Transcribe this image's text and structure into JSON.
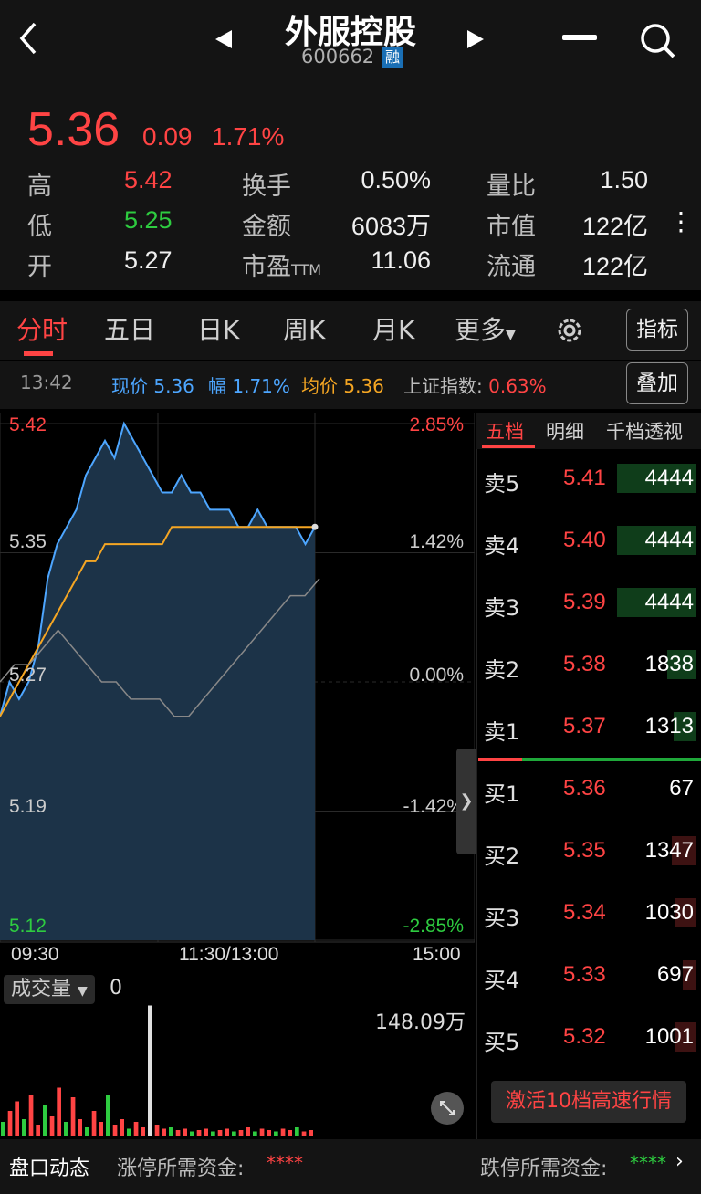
{
  "header": {
    "stock_name": "外服控股",
    "stock_code": "600662",
    "margin_badge": "融",
    "icons": [
      "back-chevron-icon",
      "prev-arrow-icon",
      "next-arrow-icon",
      "minus-icon",
      "search-icon"
    ]
  },
  "quote": {
    "price": "5.36",
    "change": "0.09",
    "change_pct": "1.71%",
    "high_label": "高",
    "high": "5.42",
    "low_label": "低",
    "low": "5.25",
    "open_label": "开",
    "open": "5.27",
    "turnover_label": "换手",
    "turnover": "0.50%",
    "amount_label": "金额",
    "amount": "6083万",
    "pe_label": "市盈",
    "pe_suffix": "TTM",
    "pe": "11.06",
    "vol_ratio_label": "量比",
    "vol_ratio": "1.50",
    "mktcap_label": "市值",
    "mktcap": "122亿",
    "float_label": "流通",
    "float": "122亿"
  },
  "tabs": {
    "items": [
      "分时",
      "五日",
      "日K",
      "周K",
      "月K",
      "更多"
    ],
    "active": "分时",
    "indicator_btn": "指标",
    "overlay_btn": "叠加"
  },
  "info": {
    "time": "13:42",
    "now_label": "现价",
    "now": "5.36",
    "amp_label": "幅",
    "amp": "1.71%",
    "avg_label": "均价",
    "avg": "5.36",
    "index_label": "上证指数:",
    "index_pct": "0.63%"
  },
  "chart_data": {
    "type": "line",
    "y_left_ticks": [
      "5.42",
      "5.35",
      "5.27",
      "5.19",
      "5.12"
    ],
    "y_right_ticks": [
      "2.85%",
      "1.42%",
      "0.00%",
      "-1.42%",
      "-2.85%"
    ],
    "x_ticks": [
      "09:30",
      "11:30/13:00",
      "15:00"
    ],
    "ylim": [
      5.12,
      5.42
    ],
    "prev_close": 5.27,
    "series": [
      {
        "values": [
          5.25,
          5.27,
          5.26,
          5.27,
          5.29,
          5.33,
          5.35,
          5.36,
          5.37,
          5.39,
          5.4,
          5.41,
          5.4,
          5.42,
          5.41,
          5.4,
          5.39,
          5.38,
          5.38,
          5.39,
          5.38,
          5.38,
          5.37,
          5.37,
          5.37,
          5.36,
          5.36,
          5.37,
          5.36,
          5.36,
          5.36,
          5.36,
          5.35,
          5.36
        ]
      },
      {
        "values": [
          5.25,
          5.26,
          5.27,
          5.28,
          5.29,
          5.3,
          5.31,
          5.32,
          5.33,
          5.34,
          5.34,
          5.35,
          5.35,
          5.35,
          5.35,
          5.35,
          5.35,
          5.35,
          5.36,
          5.36,
          5.36,
          5.36,
          5.36,
          5.36,
          5.36,
          5.36,
          5.36,
          5.36,
          5.36,
          5.36,
          5.36,
          5.36,
          5.36,
          5.36
        ]
      },
      {
        "values": [
          5.27,
          5.28,
          5.28,
          5.29,
          5.3,
          5.29,
          5.28,
          5.27,
          5.27,
          5.26,
          5.26,
          5.26,
          5.25,
          5.25,
          5.26,
          5.27,
          5.28,
          5.29,
          5.3,
          5.31,
          5.32,
          5.32,
          5.33
        ]
      }
    ],
    "colors": {
      "price": "#4da6ff",
      "avg": "#f5a623",
      "index": "#888888"
    }
  },
  "volume": {
    "label": "成交量",
    "value": "0",
    "max": "148.09万",
    "bars": [
      0.1,
      0.18,
      0.25,
      0.12,
      0.3,
      0.08,
      0.22,
      0.14,
      0.35,
      0.1,
      0.28,
      0.12,
      0.06,
      0.18,
      0.1,
      0.3,
      0.08,
      0.12,
      0.05,
      0.1,
      0.06,
      0.95,
      0.08,
      0.05,
      0.06,
      0.04,
      0.05,
      0.03,
      0.04,
      0.05,
      0.03,
      0.04,
      0.05,
      0.03,
      0.04,
      0.06,
      0.03,
      0.05,
      0.04,
      0.03,
      0.05,
      0.04,
      0.06,
      0.03,
      0.04
    ]
  },
  "orderbook": {
    "tabs": [
      "五档",
      "明细",
      "千档透视"
    ],
    "asks": [
      {
        "label": "卖5",
        "price": "5.41",
        "vol": "4444",
        "bar": 0.36
      },
      {
        "label": "卖4",
        "price": "5.40",
        "vol": "4444",
        "bar": 0.36
      },
      {
        "label": "卖3",
        "price": "5.39",
        "vol": "4444",
        "bar": 0.36
      },
      {
        "label": "卖2",
        "price": "5.38",
        "vol": "1838",
        "bar": 0.13
      },
      {
        "label": "卖1",
        "price": "5.37",
        "vol": "1313",
        "bar": 0.1
      }
    ],
    "bids": [
      {
        "label": "买1",
        "price": "5.36",
        "vol": "67",
        "bar": 0.0
      },
      {
        "label": "买2",
        "price": "5.35",
        "vol": "1347",
        "bar": 0.11
      },
      {
        "label": "买3",
        "price": "5.34",
        "vol": "1030",
        "bar": 0.09
      },
      {
        "label": "买4",
        "price": "5.33",
        "vol": "697",
        "bar": 0.06
      },
      {
        "label": "买5",
        "price": "5.32",
        "vol": "1001",
        "bar": 0.09
      }
    ],
    "activate": "激活10档高速行情"
  },
  "footer": {
    "panel": "盘口动态",
    "limit_up_label": "涨停所需资金:",
    "limit_up_value": "****",
    "limit_down_label": "跌停所需资金:",
    "limit_down_value": "****"
  }
}
